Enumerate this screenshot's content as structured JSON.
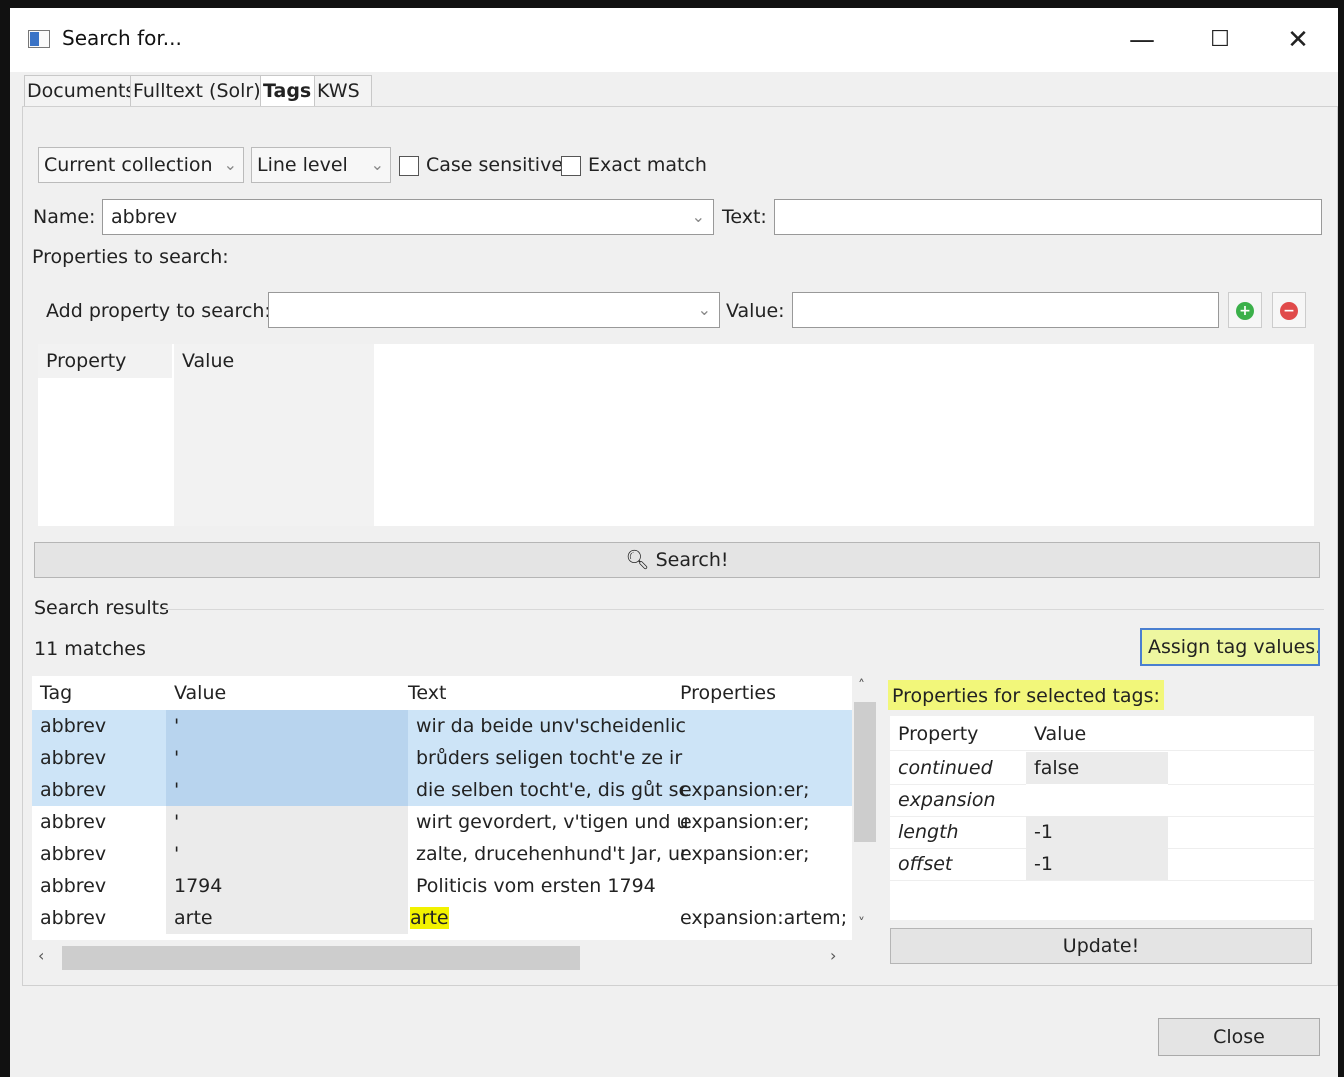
{
  "window": {
    "title": "Search for...",
    "min": "—",
    "max": "☐",
    "close": "✕"
  },
  "tabs": [
    "Documents",
    "Fulltext (Solr)",
    "Tags",
    "KWS"
  ],
  "filters": {
    "scope": "Current collection",
    "level": "Line level",
    "case_sensitive": "Case sensitive",
    "exact_match": "Exact match"
  },
  "name_label": "Name:",
  "name_value": "abbrev",
  "text_label": "Text:",
  "props_to_search": "Properties to search:",
  "add_prop_label": "Add property to search:",
  "value_label": "Value:",
  "prop_table": {
    "col1": "Property",
    "col2": "Value"
  },
  "search_button": "Search!",
  "results": {
    "section": "Search results",
    "count": "11 matches",
    "assign_button": "Assign tag values...",
    "columns": [
      "Tag",
      "Value",
      "Text",
      "Properties"
    ],
    "rows": [
      {
        "tag": "abbrev",
        "value": "'",
        "text": "wir da beide unv'scheidenlic",
        "props": "",
        "selected": true
      },
      {
        "tag": "abbrev",
        "value": "'",
        "text": "brůders seligen tocht'e ze ir",
        "props": "",
        "selected": true
      },
      {
        "tag": "abbrev",
        "value": "'",
        "text": "die selben tocht'e, dis gůt sc",
        "props": "expansion:er;",
        "selected": true
      },
      {
        "tag": "abbrev",
        "value": "'",
        "text": "wirt gevordert, v'tigen und u",
        "props": "expansion:er;",
        "selected": false
      },
      {
        "tag": "abbrev",
        "value": "'",
        "text": "zalte, drucehenhund't Jar, un",
        "props": "expansion:er;",
        "selected": false
      },
      {
        "tag": "abbrev",
        "value": "1794",
        "text": "Politicis vom ersten 1794",
        "props": "",
        "selected": false
      },
      {
        "tag": "abbrev",
        "value": "arte",
        "text": "arte",
        "props": "expansion:artem;",
        "selected": false
      }
    ]
  },
  "selected_props": {
    "title": "Properties for selected tags:",
    "columns": [
      "Property",
      "Value"
    ],
    "rows": [
      {
        "key": "continued",
        "value": "false"
      },
      {
        "key": "expansion",
        "value": ""
      },
      {
        "key": "length",
        "value": "-1"
      },
      {
        "key": "offset",
        "value": "-1"
      }
    ],
    "update_button": "Update!"
  },
  "close_button": "Close"
}
